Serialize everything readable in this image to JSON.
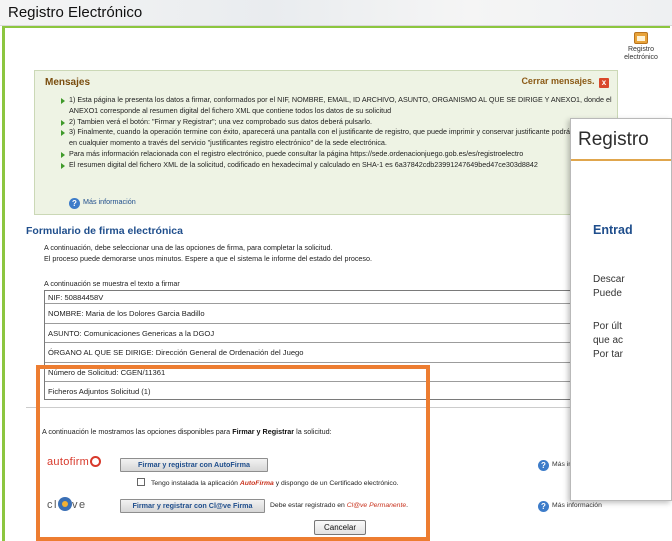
{
  "window": {
    "title": "Registro Electrónico"
  },
  "toolbar": {
    "registro_icon_label_1": "Registro",
    "registro_icon_label_2": "electrónico"
  },
  "mensajes": {
    "title": "Mensajes",
    "close_label": "Cerrar mensajes.",
    "close_x": "x",
    "items": [
      "1) Esta página le presenta los datos a firmar, conformados por el NIF, NOMBRE, EMAIL, ID ARCHIVO, ASUNTO, ORGANISMO AL QUE SE DIRIGE Y ANEXO1, donde el ANEXO1 corresponde al resumen digital del fichero XML que contiene todos los datos de su solicitud",
      "2) Tambien verá el botón: \"Firmar y Registrar\"; una vez comprobado sus datos deberá pulsarlo.",
      "3) Finalmente, cuando la operación termine con éxito, aparecerá una pantalla con el justificante de registro, que puede imprimir y conservar justificante podrá consultarlo en cualquier momento a través del servicio \"justificantes registro electrónico\" de la sede electrónica.",
      "Para más información relacionada con el registro electrónico, puede consultar la página https://sede.ordenacionjuego.gob.es/es/registroelectro",
      "El resumen digital del fichero XML de la solicitud, codificado en hexadecimal y calculado en SHA-1 es 6a37842cdb23991247649bed47ce303d8842"
    ],
    "more_info": "Más información"
  },
  "form": {
    "title": "Formulario de firma electrónica",
    "desc_line1": "A continuación, debe seleccionar una de las opciones de firma, para completar la solicitud.",
    "desc_line2": "El proceso puede demorarse unos minutos. Espere a que el sistema le informe del estado del proceso.",
    "text_intro": "A continuación se muestra el texto a firmar",
    "text_rows": [
      "NIF: 50884458V",
      "NOMBRE: Maria de los Dolores Garcia Badillo",
      "ASUNTO: Comunicaciones Genericas a la DGOJ",
      "ÓRGANO AL QUE SE DIRIGE: Dirección General de Ordenación del Juego",
      "Número de Solicitud: CGEN/11361",
      "Ficheros Adjuntos Solicitud (1)"
    ]
  },
  "options": {
    "intro_prefix": "A continuación le mostramos las opciones disponibles para ",
    "intro_bold": "Firmar y Registrar",
    "intro_suffix": " la solicitud:",
    "autofirma_logo": "autofirm",
    "autofirma_button": "Firmar y registrar con AutoFirma",
    "autofirma_check_prefix": "Tengo instalada la aplicación ",
    "autofirma_check_app": "AutoFirma",
    "autofirma_check_suffix": " y dispongo de un Certificado electrónico.",
    "clave_logo": "cl  ve",
    "clave_button": "Firmar y registrar con Cl@ve Firma",
    "clave_note_prefix": "Debe estar registrado en ",
    "clave_note_link": "Cl@ve Permanente",
    "clave_note_suffix": ".",
    "cancel_button": "Cancelar",
    "more_info_1": "Más infor",
    "more_info_2": "Más información"
  },
  "overlay": {
    "title": "Registro",
    "heading": "Entrad",
    "lines": [
      "Descar",
      "Puede",
      "Por últ",
      "que ac",
      "Por tar"
    ]
  },
  "colors": {
    "link": "#1f4e8c",
    "highlight_border": "#ed7d31",
    "frame": "#8cc63f",
    "messages_bg": "#eef3e4"
  }
}
